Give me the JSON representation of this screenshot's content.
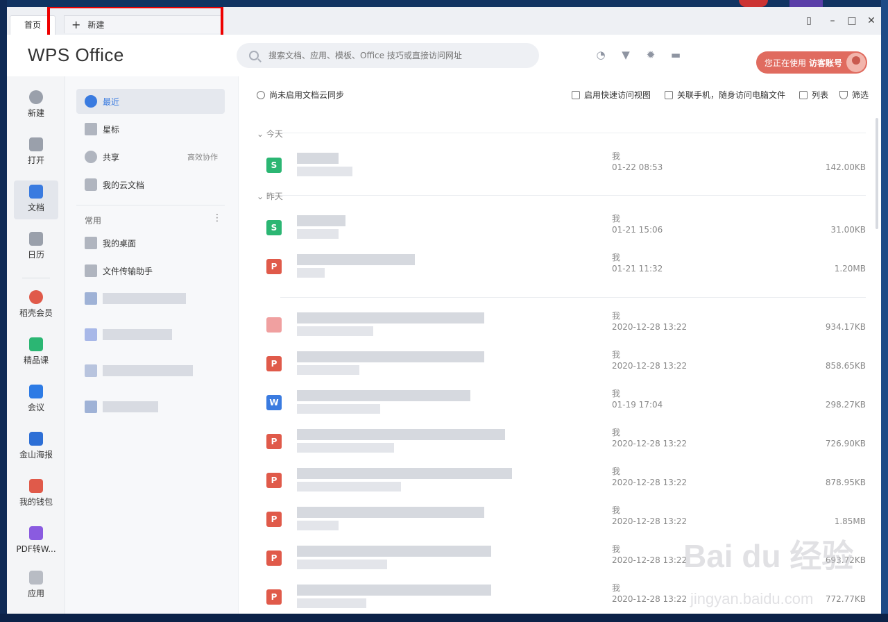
{
  "tabs": {
    "home": "首页",
    "new": "新建"
  },
  "header": {
    "logo": "WPS Office",
    "search_placeholder": "搜索文档、应用、模板、Office 技巧或直接访问网址",
    "account_prefix": "您正在使用",
    "account_name": "访客账号"
  },
  "nav": [
    {
      "label": "新建",
      "icon": "plus-circle-icon",
      "color": "#9aa0ab"
    },
    {
      "label": "打开",
      "icon": "folder-icon",
      "color": "#9aa0ab"
    },
    {
      "label": "文档",
      "icon": "document-icon",
      "color": "#3a7be0"
    },
    {
      "label": "日历",
      "icon": "calendar-icon",
      "color": "#9aa0ab"
    },
    {
      "label": "稻壳会员",
      "icon": "flame-icon",
      "color": "#e05a4a"
    },
    {
      "label": "精品课",
      "icon": "graduation-cap-icon",
      "color": "#2bb673"
    },
    {
      "label": "会议",
      "icon": "video-icon",
      "color": "#2d7be5"
    },
    {
      "label": "金山海报",
      "icon": "poster-icon",
      "color": "#2d6fd6"
    },
    {
      "label": "我的钱包",
      "icon": "wallet-icon",
      "color": "#e05a4a"
    },
    {
      "label": "PDF转W...",
      "icon": "pdf-convert-icon",
      "color": "#8a5be0"
    },
    {
      "label": "应用",
      "icon": "apps-icon",
      "color": "#9aa0ab"
    }
  ],
  "sidebar": {
    "recent": "最近",
    "starred": "星标",
    "shared": "共享",
    "shared_extra": "高效协作",
    "cloud": "我的云文档",
    "section": "常用",
    "desktop": "我的桌面",
    "transfer": "文件传输助手"
  },
  "toolbar": {
    "sync": "尚未启用文档云同步",
    "quick_view": "启用快速访问视图",
    "phone": "关联手机，随身访问电脑文件",
    "list": "列表",
    "filter": "筛选"
  },
  "groups": {
    "today": "今天",
    "yesterday": "昨天"
  },
  "files": [
    {
      "type": "S",
      "color": "#2bb673",
      "owner": "我",
      "date": "01-22 08:53",
      "size": "142.00KB"
    },
    {
      "type": "S",
      "color": "#2bb673",
      "owner": "我",
      "date": "01-21 15:06",
      "size": "31.00KB"
    },
    {
      "type": "P",
      "color": "#e05a4a",
      "owner": "我",
      "date": "01-21 11:32",
      "size": "1.20MB"
    },
    {
      "type": "",
      "color": "#f0a0a0",
      "owner": "我",
      "date": "2020-12-28 13:22",
      "size": "934.17KB"
    },
    {
      "type": "P",
      "color": "#e05a4a",
      "owner": "我",
      "date": "2020-12-28 13:22",
      "size": "858.65KB"
    },
    {
      "type": "W",
      "color": "#3a7be0",
      "owner": "我",
      "date": "01-19 17:04",
      "size": "298.27KB"
    },
    {
      "type": "P",
      "color": "#e05a4a",
      "owner": "我",
      "date": "2020-12-28 13:22",
      "size": "726.90KB"
    },
    {
      "type": "P",
      "color": "#e05a4a",
      "owner": "我",
      "date": "2020-12-28 13:22",
      "size": "878.95KB"
    },
    {
      "type": "P",
      "color": "#e05a4a",
      "owner": "我",
      "date": "2020-12-28 13:22",
      "size": "1.85MB"
    },
    {
      "type": "P",
      "color": "#e05a4a",
      "owner": "我",
      "date": "2020-12-28 13:22",
      "size": "693.72KB"
    },
    {
      "type": "P",
      "color": "#e05a4a",
      "owner": "我",
      "date": "2020-12-28 13:22",
      "size": "772.77KB"
    }
  ],
  "watermark": {
    "brand": "Bai du 经验",
    "url": "jingyan.baidu.com"
  }
}
